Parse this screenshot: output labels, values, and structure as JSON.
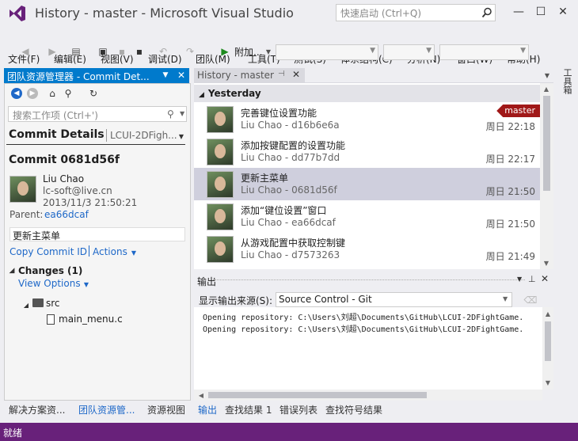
{
  "window": {
    "title": "History - master - Microsoft Visual Studio",
    "quick_launch_placeholder": "快速启动 (Ctrl+Q)"
  },
  "menu": [
    "文件(F)",
    "编辑(E)",
    "视图(V)",
    "调试(D)",
    "团队(M)",
    "工具(T)",
    "测试(S)",
    "体系结构(C)",
    "分析(N)",
    "窗口(W)",
    "帮助(H)"
  ],
  "toolbar": {
    "attach_label": "附加..."
  },
  "right_rail": {
    "label": "工具箱"
  },
  "team_explorer": {
    "title": "团队资源管理器 - Commit Det...",
    "search_placeholder": "搜索工作项 (Ctrl+')",
    "page_title": "Commit Details",
    "page_sub": "LCUI-2DFigh...",
    "commit_heading": "Commit 0681d56f",
    "author_name": "Liu Chao",
    "author_email": "lc-soft@live.cn",
    "date": "2013/11/3 21:50:21",
    "parent_label": "Parent:",
    "parent_id": "ea66dcaf",
    "message": "更新主菜单",
    "copy_link": "Copy Commit ID",
    "actions_link": "Actions",
    "changes_title": "Changes (1)",
    "view_options": "View Options",
    "folder": "src",
    "file": "main_menu.c"
  },
  "history": {
    "tab_label": "History - master",
    "group": "Yesterday",
    "branch": "master",
    "commits": [
      {
        "message": "完善键位设置功能",
        "author": "Liu Chao - d16b6e6a",
        "time": "周日 22:18"
      },
      {
        "message": "添加按键配置的设置功能",
        "author": "Liu Chao - dd77b7dd",
        "time": "周日 22:17"
      },
      {
        "message": "更新主菜单",
        "author": "Liu Chao - 0681d56f",
        "time": "周日 21:50"
      },
      {
        "message": "添加“键位设置”窗口",
        "author": "Liu Chao - ea66dcaf",
        "time": "周日 21:50"
      },
      {
        "message": "从游戏配置中获取控制键",
        "author": "Liu Chao - d7573263",
        "time": "周日 21:49"
      }
    ]
  },
  "output": {
    "title": "输出",
    "source_label": "显示输出来源(S):",
    "source_value": "Source Control - Git",
    "lines": [
      "Opening repository: C:\\Users\\刘超\\Documents\\GitHub\\LCUI-2DFightGame.",
      "Opening repository: C:\\Users\\刘超\\Documents\\GitHub\\LCUI-2DFightGame."
    ]
  },
  "left_tabs": [
    "解决方案资...",
    "团队资源管...",
    "资源视图"
  ],
  "bottom_tabs": [
    "输出",
    "查找结果 1",
    "错误列表",
    "查找符号结果"
  ],
  "status": "就绪"
}
